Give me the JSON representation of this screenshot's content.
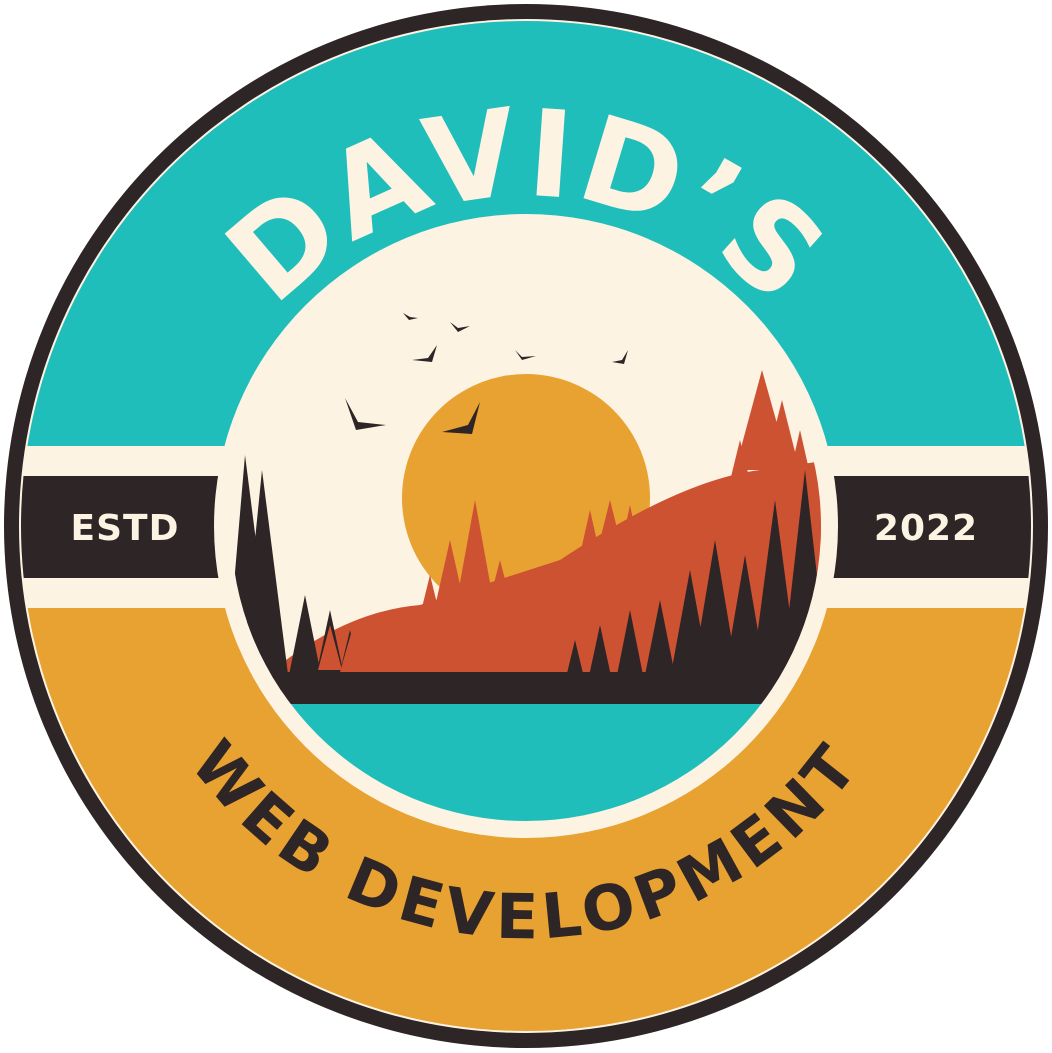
{
  "badge": {
    "title": "DAVID’S",
    "subtitle": "WEB DEVELOPMENT",
    "left_band_label": "ESTD",
    "right_band_label": "2022"
  },
  "scene": {
    "icons": [
      "sun-icon",
      "bird-icon",
      "mountain-icon",
      "pine-tree-icon"
    ]
  },
  "colors": {
    "outer_ring": "#2e2526",
    "cream": "#fdf3e3",
    "teal": "#20bebb",
    "mustard": "#e8a232",
    "rust": "#cd5232",
    "dark": "#2e2526"
  }
}
